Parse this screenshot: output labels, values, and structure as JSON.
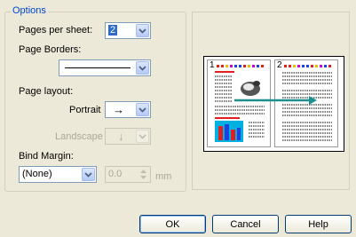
{
  "group_title": "Options",
  "pages_per_sheet": {
    "label": "Pages per sheet:",
    "value": "2"
  },
  "page_borders": {
    "label": "Page Borders:"
  },
  "page_layout": {
    "label": "Page layout:",
    "portrait": {
      "label": "Portrait",
      "value": "→"
    },
    "landscape": {
      "label": "Landscape",
      "value": "↓"
    }
  },
  "bind_margin": {
    "label": "Bind Margin:",
    "value": "(None)",
    "amount": "0.0",
    "unit": "mm"
  },
  "preview": {
    "page1_number": "1",
    "page2_number": "2"
  },
  "buttons": {
    "ok": "OK",
    "cancel": "Cancel",
    "help": "Help"
  }
}
